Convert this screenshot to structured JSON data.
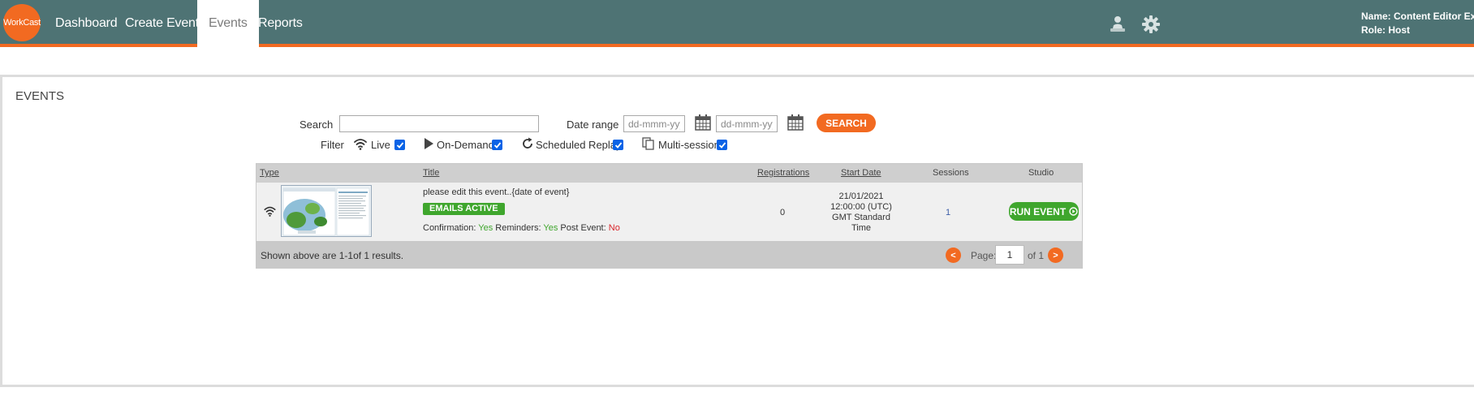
{
  "nav": {
    "logo": "WorkCast",
    "items": [
      "Dashboard",
      "Create Events",
      "Events",
      "Reports"
    ],
    "active": "Events",
    "user_name": "Name: Content Editor Ex",
    "user_role": "Role: Host",
    "icons": [
      "presenter-icon",
      "gear-icon"
    ]
  },
  "panel": {
    "title": "EVENTS"
  },
  "search": {
    "label": "Search",
    "value": "",
    "date_range_label": "Date range",
    "date_from_placeholder": "dd-mmm-yyyy",
    "date_to_placeholder": "dd-mmm-yyyy",
    "button": "SEARCH"
  },
  "filter": {
    "label": "Filter",
    "options": [
      {
        "label": "Live",
        "checked": true,
        "icon": "wifi-icon"
      },
      {
        "label": "On-Demand",
        "checked": true,
        "icon": "play-icon"
      },
      {
        "label": "Scheduled Replay",
        "checked": true,
        "icon": "replay-icon"
      },
      {
        "label": "Multi-session",
        "checked": true,
        "icon": "copy-icon"
      }
    ]
  },
  "table": {
    "columns": [
      "Type",
      "Title",
      "Registrations",
      "Start Date",
      "Sessions",
      "Studio"
    ],
    "rows": [
      {
        "type_icon": "wifi-icon",
        "title": "please edit this event..{date of event}",
        "badge": "EMAILS ACTIVE",
        "confirmation_label": "Confirmation:",
        "confirmation": "Yes",
        "reminders_label": "Reminders:",
        "reminders": "Yes",
        "post_event_label": "Post Event:",
        "post_event": "No",
        "registrations": "0",
        "start_date": [
          "21/01/2021",
          "12:00:00 (UTC)",
          "GMT Standard",
          "Time"
        ],
        "sessions": "1",
        "studio_button": "RUN EVENT"
      }
    ],
    "footer": {
      "results": "Shown above are 1-1of 1 results.",
      "prev": "<",
      "page_label": "Page:",
      "page_value": "1",
      "of_label": "of 1",
      "next": ">"
    }
  },
  "colors": {
    "header": "#4e7374",
    "accent": "#f26a21",
    "success": "#3fa62d",
    "danger": "#d9262b"
  }
}
